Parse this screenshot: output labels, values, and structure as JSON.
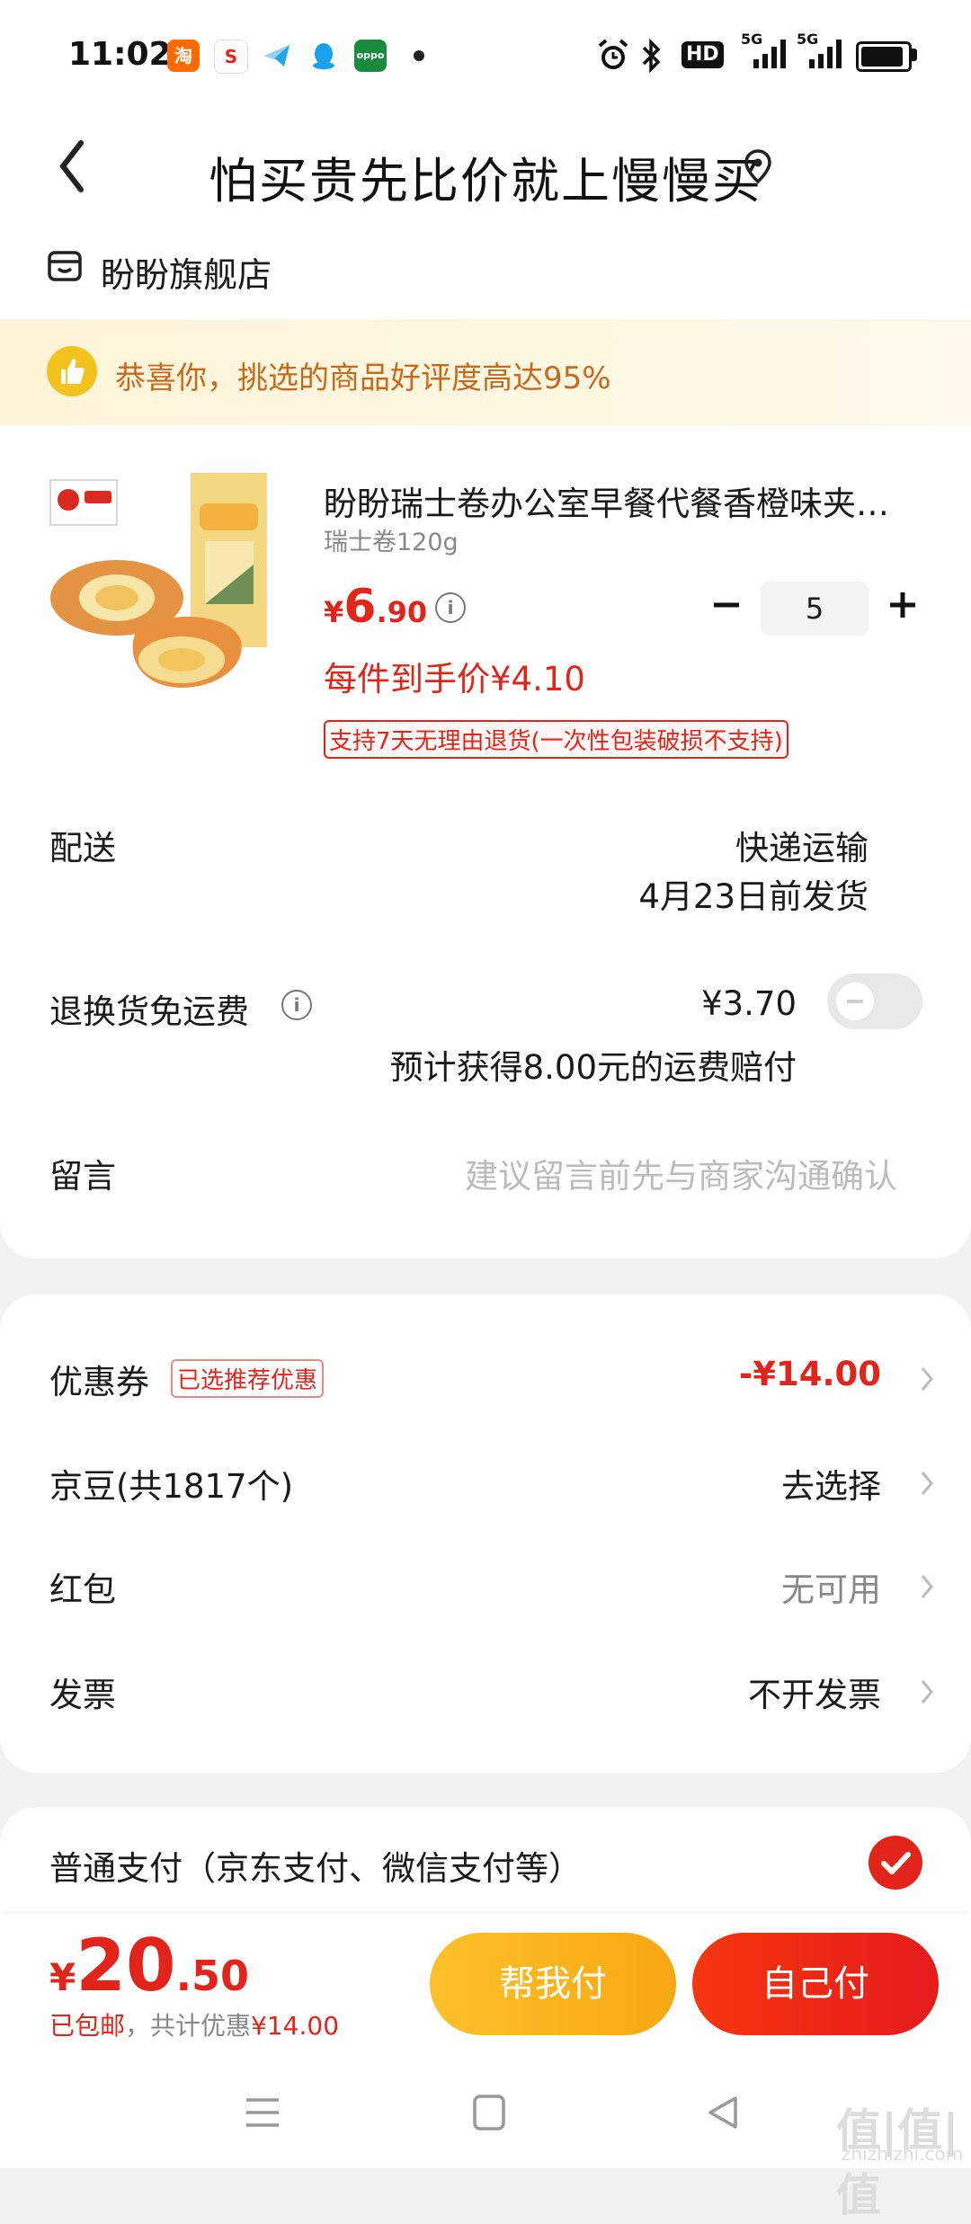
{
  "status_bar": {
    "time": "11:02",
    "app_icons": [
      "淘",
      "S",
      "",
      "",
      ""
    ],
    "hd_label": "HD",
    "net": [
      "5G",
      "5G"
    ]
  },
  "header": {
    "title": "怕买贵先比价就上慢慢买"
  },
  "shop": {
    "name": "盼盼旗舰店"
  },
  "banner": {
    "text": "恭喜你，挑选的商品好评度高达95%"
  },
  "product": {
    "name": "盼盼瑞士卷办公室早餐代餐香橙味夹心蛋糕",
    "spec": "瑞士卷120g",
    "price_currency": "¥",
    "price_int": "6",
    "price_dec": ".90",
    "quantity": "5",
    "unit_price": "每件到手价¥4.10",
    "return_tag": "支持7天无理由退货(一次性包装破损不支持)"
  },
  "delivery": {
    "label": "配送",
    "method": "快递运输",
    "date": "4月23日前发货"
  },
  "return_insurance": {
    "label": "退换货免运费",
    "price": "¥3.70",
    "note": "预计获得8.00元的运费赔付",
    "enabled": false
  },
  "message": {
    "label": "留言",
    "placeholder": "建议留言前先与商家沟通确认"
  },
  "discounts": {
    "coupon_label": "优惠券",
    "coupon_tag": "已选推荐优惠",
    "coupon_value": "-¥14.00",
    "beans_label": "京豆(共1817个)",
    "beans_value": "去选择",
    "redpack_label": "红包",
    "redpack_value": "无可用",
    "invoice_label": "发票",
    "invoice_value": "不开发票"
  },
  "payment": {
    "label": "普通支付（京东支付、微信支付等）",
    "selected": true
  },
  "bottom_bar": {
    "total_currency": "¥",
    "total_int": "20",
    "total_dec": ".50",
    "shipping": "已包邮",
    "separator": "，",
    "saved": "共计优惠",
    "saved_value": "¥14.00",
    "help_pay": "帮我付",
    "self_pay": "自己付"
  },
  "watermark": {
    "main": "值|值|值",
    "sub": "zhizhizhi.com"
  },
  "colors": {
    "accent_red": "#e1251b",
    "accent_yellow": "#fcc12a",
    "banner_text": "#c9691c"
  }
}
